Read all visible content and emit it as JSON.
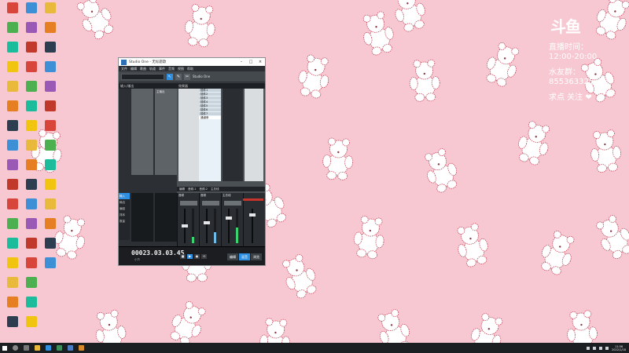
{
  "overlay": {
    "logo": "斗鱼",
    "line1": "直播时间：",
    "line2": "12:00-20:00",
    "line3": "水友群：",
    "line4": "855363325",
    "line5": "求点 关注 ❤"
  },
  "window": {
    "title": "Studio One - 无标题歌",
    "min_icon": "–",
    "max_icon": "□",
    "close_icon": "×",
    "menus": [
      "文件",
      "编辑",
      "歌曲",
      "轨道",
      "事件",
      "音频",
      "视图",
      "帮助"
    ],
    "toolbar": {
      "tool1": "↖",
      "tool2": "✎",
      "tool3": "✂",
      "label": "Studio One"
    }
  },
  "mixer": {
    "left_head": "输入/输出",
    "left_tab": "主输出",
    "insert_head": "效果器",
    "insert_items": [
      "插件1",
      "插件2",
      "插件3",
      "插件4",
      "插件5",
      "插件6",
      "插件7",
      "插件8",
      "插件9"
    ],
    "insert_selected": "通道条",
    "labels": [
      "编辑",
      "音频-1",
      "音频-2",
      "主总线"
    ],
    "strip_names": [
      "音频",
      "音频",
      "主总线"
    ],
    "side_tabs": [
      "输入",
      "输出",
      "编组",
      "排序",
      "数量"
    ]
  },
  "transport": {
    "time": "00023.03.03.45",
    "sub": "小节",
    "buttons": [
      "■",
      "▶",
      "●",
      "⟲"
    ],
    "modes": [
      "编辑",
      "混音",
      "浏览"
    ]
  },
  "taskbar": {
    "time": "11:56",
    "date": "2022/1/18"
  },
  "colors": {
    "wallpaper": "#f7c8d1",
    "accent": "#2f8fe0",
    "meter": "#3ad36f"
  }
}
